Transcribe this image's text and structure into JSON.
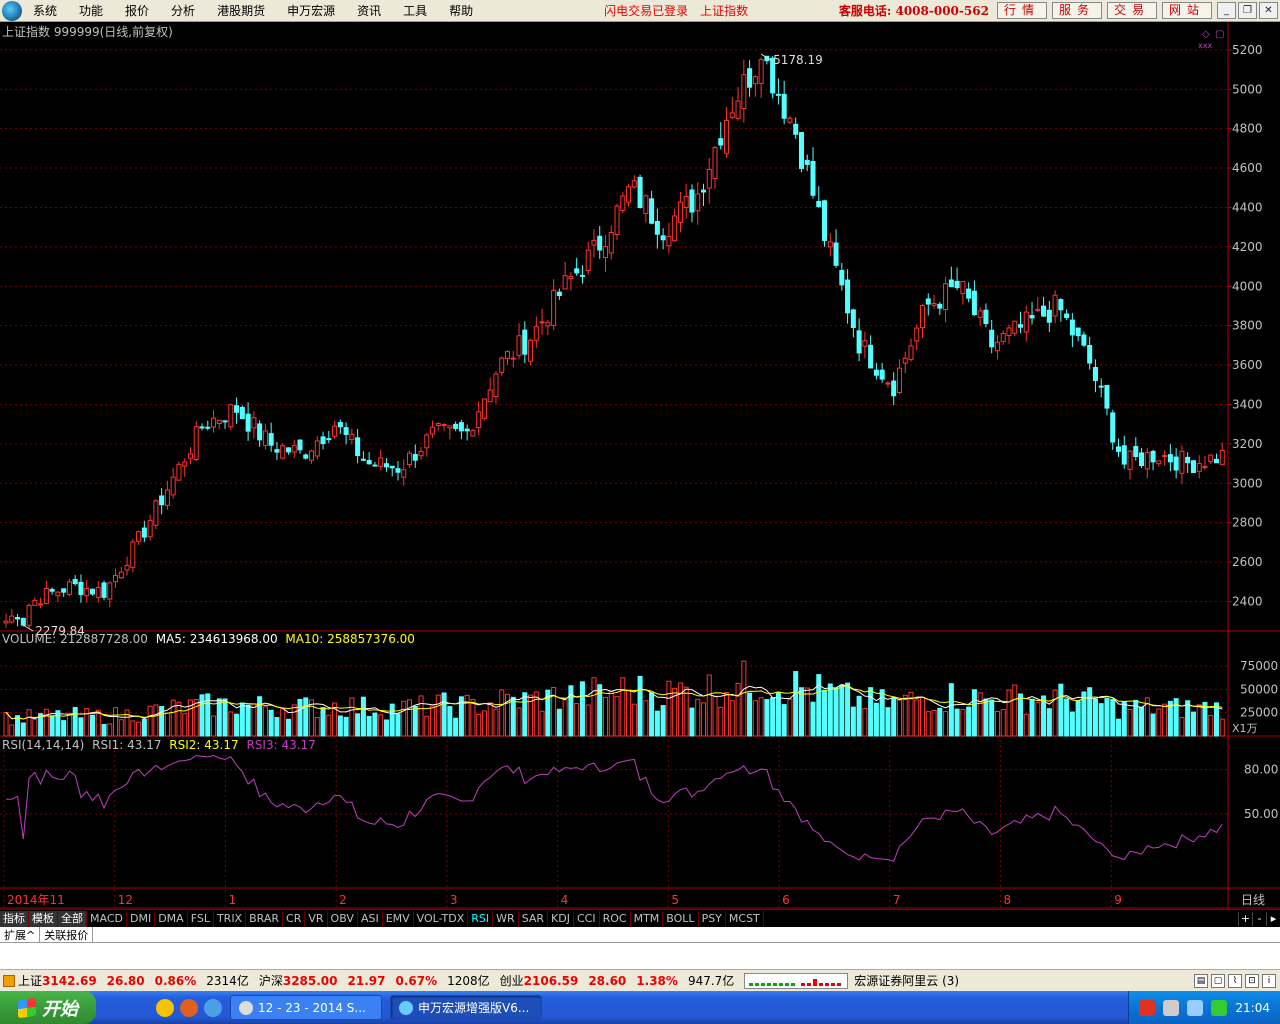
{
  "menubar": {
    "items": [
      "系统",
      "功能",
      "报价",
      "分析",
      "港股期货",
      "申万宏源",
      "资讯",
      "工具",
      "帮助"
    ],
    "status": "闪电交易已登录",
    "index_name": "上证指数",
    "hotline": "客服电话: 4008-000-562",
    "service_buttons": [
      "行情",
      "服务",
      "交易",
      "网站"
    ]
  },
  "chart_header": "上证指数 999999(日线,前复权)",
  "price_panel": {
    "yticks": [
      "5200",
      "5000",
      "4800",
      "4600",
      "4400",
      "4200",
      "4000",
      "3800",
      "3600",
      "3400",
      "3200",
      "3000",
      "2800",
      "2600",
      "2400"
    ],
    "high_label": "5178.19",
    "low_label": "2279.84"
  },
  "volume_panel": {
    "label": "VOLUME: 212887728.00",
    "ma5": "MA5: 234613968.00",
    "ma10": "MA10: 258857376.00",
    "yticks": [
      "75000",
      "50000",
      "25000"
    ],
    "unit": "X1万"
  },
  "rsi_panel": {
    "label": "RSI(14,14,14)",
    "rsi1": "RSI1: 43.17",
    "rsi2": "RSI2: 43.17",
    "rsi3": "RSI3: 43.17",
    "yticks": [
      "80.00",
      "50.00"
    ]
  },
  "time_axis": {
    "labels": [
      "2014年11",
      "12",
      "1",
      "2",
      "3",
      "4",
      "5",
      "6",
      "7",
      "8",
      "9"
    ],
    "period": "日线"
  },
  "indicator_tabs": [
    "指标",
    "模板",
    "全部",
    "MACD",
    "DMI",
    "DMA",
    "FSL",
    "TRIX",
    "BRAR",
    "CR",
    "VR",
    "OBV",
    "ASI",
    "EMV",
    "VOL-TDX",
    "RSI",
    "WR",
    "SAR",
    "KDJ",
    "CCI",
    "ROC",
    "MTM",
    "BOLL",
    "PSY",
    "MCST"
  ],
  "indicator_active": "RSI",
  "ext_tabs": [
    "扩展^",
    "关联报价"
  ],
  "statusbar": {
    "items": [
      {
        "name": "上证",
        "price": "3142.69",
        "chg": "26.80",
        "pct": "0.86%",
        "vol": "2314亿"
      },
      {
        "name": "沪深",
        "price": "3285.00",
        "chg": "21.97",
        "pct": "0.67%",
        "vol": "1208亿"
      },
      {
        "name": "创业",
        "price": "2106.59",
        "chg": "28.60",
        "pct": "1.38%",
        "vol": "947.7亿"
      }
    ],
    "news": "宏源证券阿里云 (3)"
  },
  "taskbar": {
    "start": "开始",
    "windows": [
      "12 - 23 - 2014 S...",
      "申万宏源增强版V6..."
    ],
    "clock": "21:04"
  },
  "colors": {
    "up": "#ff3232",
    "down": "#54ffff",
    "rsi": "#c040c0",
    "ma5": "#ffffff",
    "ma10": "#ffff00",
    "grid": "#7a0000"
  },
  "chart_data": {
    "type": "candlestick",
    "title": "上证指数 999999(日线,前复权)",
    "price_range": [
      2279.84,
      5178.19
    ],
    "ylim_price": [
      2250,
      5250
    ],
    "anchor_closes": [
      {
        "month": "2014-11",
        "close": 2300
      },
      {
        "month": "2014-12",
        "close": 2680
      },
      {
        "month": "2015-01",
        "close": 3210
      },
      {
        "month": "2015-02",
        "close": 3100
      },
      {
        "month": "2015-03",
        "close": 3250
      },
      {
        "month": "2015-04",
        "close": 3750
      },
      {
        "month": "2015-05",
        "close": 4450
      },
      {
        "month": "2015-06",
        "close": 4900
      },
      {
        "month": "2015-07",
        "close": 3700
      },
      {
        "month": "2015-08",
        "close": 3900
      },
      {
        "month": "2015-09",
        "close": 3140
      }
    ],
    "volume_ma": {
      "ma5": 234613968.0,
      "ma10": 258857376.0,
      "last": 212887728.0
    },
    "rsi_last": 43.17,
    "rsi_ylim": [
      0,
      100
    ]
  }
}
